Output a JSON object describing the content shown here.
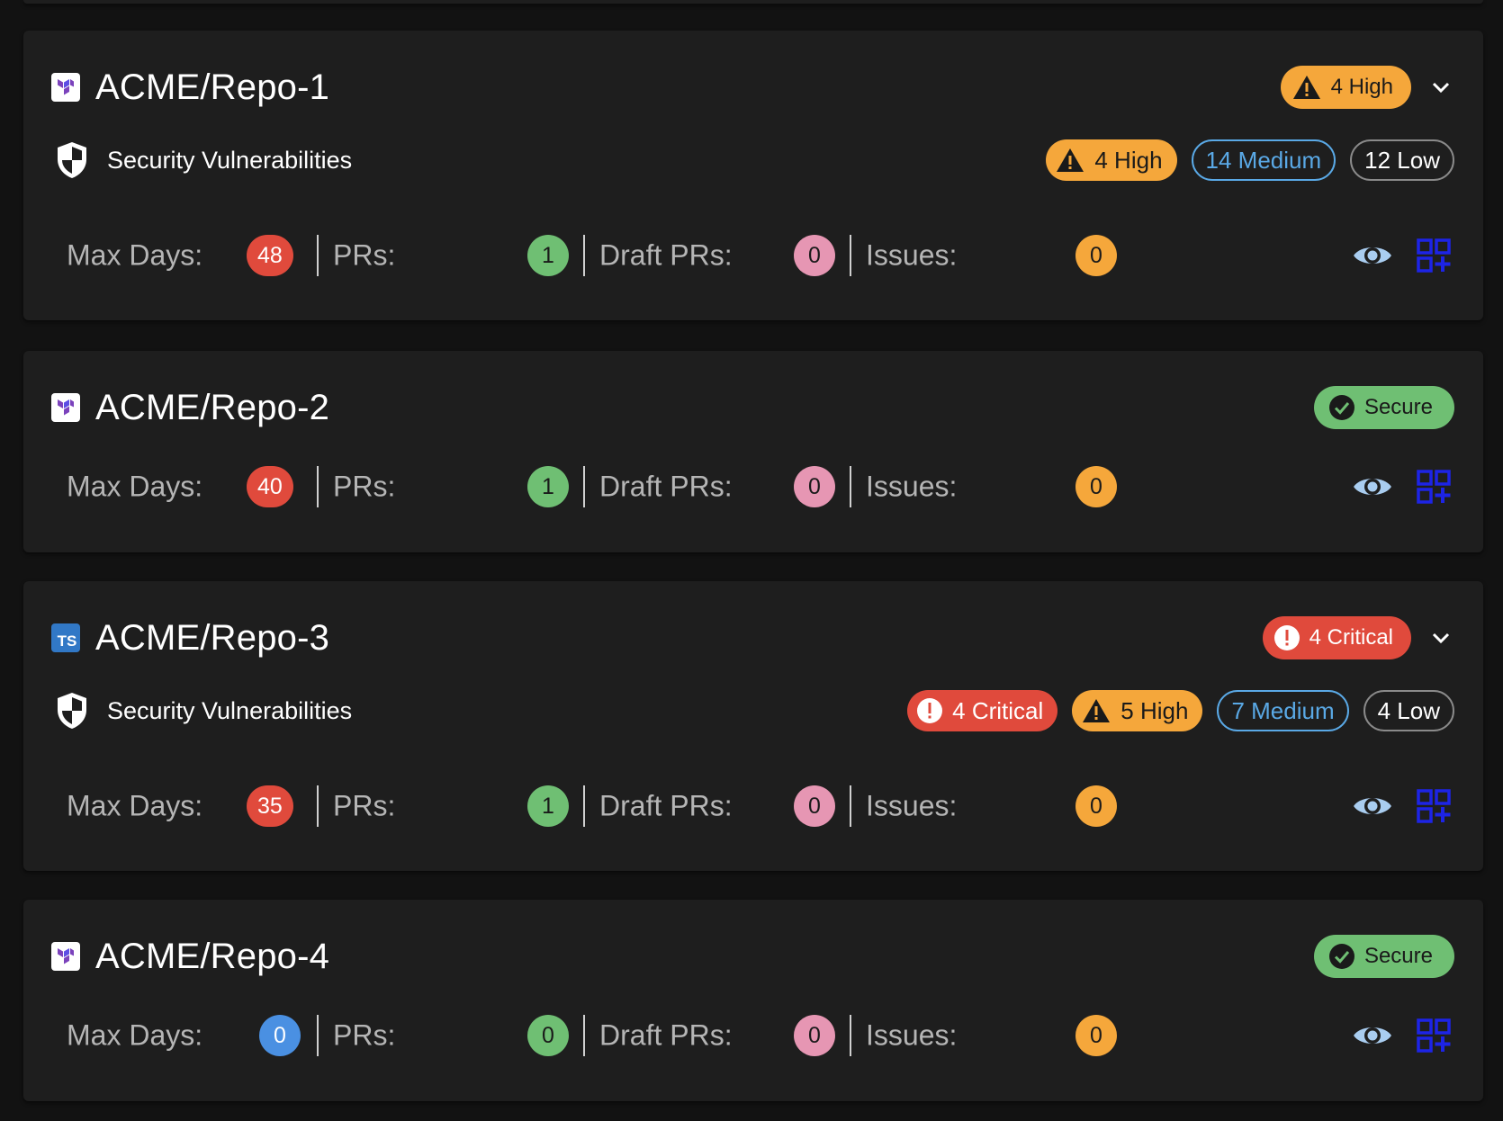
{
  "colors": {
    "background": "#121212",
    "card": "#1e1e1e",
    "high": "#f5a73b",
    "critical": "#e04a3c",
    "secure": "#6fbf73",
    "medium": "#5aa9e6",
    "max_days_red": "#e04a3c",
    "max_days_blue": "#4a90e2",
    "prs_green": "#6fbf73",
    "draft_pink": "#e696b3",
    "issues_orange": "#f5a73b",
    "eye_icon": "#a9cdf0",
    "apps_icon": "#1d24e6"
  },
  "labels": {
    "max_days": "Max Days:",
    "prs": "PRs:",
    "draft_prs": "Draft PRs:",
    "issues": "Issues:",
    "security_vulnerabilities": "Security Vulnerabilities",
    "ts_icon_text": "TS"
  },
  "repos": [
    {
      "name": "ACME/Repo-1",
      "icon": "terraform-icon",
      "status": "4 High",
      "vulnerabilities": {
        "high": "4 High",
        "medium": "14 Medium",
        "low": "12 Low"
      },
      "max_days": "48",
      "prs": "1",
      "draft_prs": "0",
      "issues": "0"
    },
    {
      "name": "ACME/Repo-2",
      "icon": "terraform-icon",
      "status": "Secure",
      "max_days": "40",
      "prs": "1",
      "draft_prs": "0",
      "issues": "0"
    },
    {
      "name": "ACME/Repo-3",
      "icon": "typescript-icon",
      "status": "4 Critical",
      "vulnerabilities": {
        "critical": "4 Critical",
        "high": "5 High",
        "medium": "7 Medium",
        "low": "4 Low"
      },
      "max_days": "35",
      "prs": "1",
      "draft_prs": "0",
      "issues": "0"
    },
    {
      "name": "ACME/Repo-4",
      "icon": "terraform-icon",
      "status": "Secure",
      "max_days": "0",
      "prs": "0",
      "draft_prs": "0",
      "issues": "0"
    }
  ]
}
